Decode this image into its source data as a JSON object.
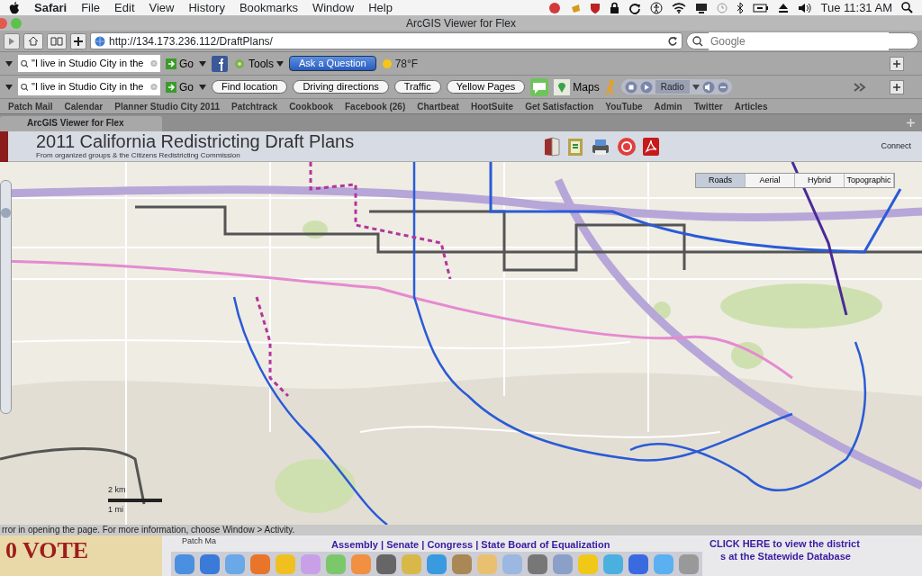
{
  "menu_bar": {
    "items": [
      "Safari",
      "File",
      "Edit",
      "View",
      "History",
      "Bookmarks",
      "Window",
      "Help"
    ],
    "clock": "Tue 11:31 AM"
  },
  "window": {
    "title": "ArcGIS Viewer for Flex"
  },
  "address_bar": {
    "url": "http://134.173.236.112/DraftPlans/",
    "search_placeholder": "Google"
  },
  "toolbars": [
    {
      "search_value": "\"I live in Studio City in the",
      "go": "Go",
      "items": [
        {
          "kind": "logo-tile"
        },
        {
          "kind": "menu",
          "label": "Tools"
        },
        {
          "kind": "action",
          "label": "Ask a Question"
        },
        {
          "kind": "weather",
          "label": "78°F"
        }
      ]
    },
    {
      "search_value": "\"I live in Studio City in the",
      "go": "Go",
      "items": [
        {
          "kind": "pill",
          "label": "Find location"
        },
        {
          "kind": "pill",
          "label": "Driving directions"
        },
        {
          "kind": "pill",
          "label": "Traffic"
        },
        {
          "kind": "pill",
          "label": "Yellow Pages"
        },
        {
          "kind": "chat-tile"
        },
        {
          "kind": "maps",
          "label": "Maps"
        },
        {
          "kind": "figure"
        },
        {
          "kind": "radio",
          "label": "Radio"
        }
      ]
    }
  ],
  "bookmarks": [
    "Patch Mail",
    "Calendar",
    "Planner Studio City 2011",
    "Patchtrack",
    "Cookbook",
    "Facebook (26)",
    "Chartbeat",
    "HootSuite",
    "Get Satisfaction",
    "YouTube",
    "Admin",
    "Twitter",
    "Articles"
  ],
  "tabs": [
    {
      "label": "ArcGIS Viewer for Flex",
      "selected": true
    }
  ],
  "app": {
    "title": "2011 California Redistricting Draft Plans",
    "subtitle": "From organized groups & the Citizens Redistricting Commission",
    "connect": "Connect"
  },
  "map": {
    "layer_buttons": [
      {
        "label": "Roads",
        "selected": true
      },
      {
        "label": "Aerial",
        "selected": false
      },
      {
        "label": "Hybrid",
        "selected": false
      },
      {
        "label": "Topographic",
        "selected": false
      }
    ],
    "scale": {
      "km": "2 km",
      "mi": "1 mi"
    },
    "zoom": {
      "level": 0.88
    }
  },
  "status_bar": {
    "text": "rror in opening the page. For more information, choose Window > Activity."
  },
  "background_page": {
    "banner": "0 VOTE",
    "tab": "Patch Ma",
    "links": "Assembly | Senate | Congress | State Board of Equalization",
    "link_1": "CLICK HERE to view the district",
    "link_2": "s at the Statewide Database"
  }
}
